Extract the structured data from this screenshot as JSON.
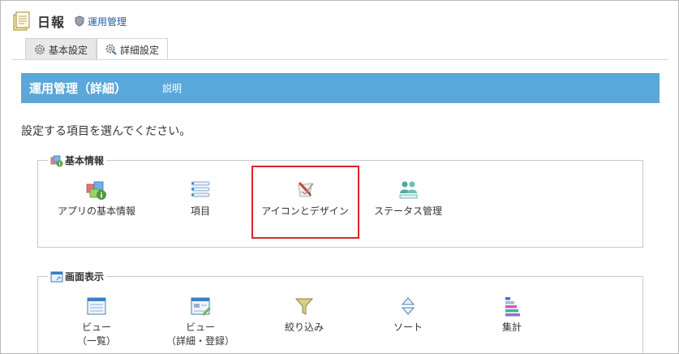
{
  "header": {
    "app_name": "日報",
    "admin_link": "運用管理"
  },
  "tabs": [
    {
      "label": "基本設定",
      "active": false
    },
    {
      "label": "詳細設定",
      "active": true
    }
  ],
  "title_bar": {
    "title": "運用管理（詳細）",
    "help": "説明",
    "color": "#5aa7d9"
  },
  "instruction": "設定する項目を選んでください。",
  "groups": {
    "basic": {
      "legend": "基本情報",
      "items": [
        {
          "label": "アプリの基本情報",
          "icon": "app-info-icon"
        },
        {
          "label": "項目",
          "icon": "fields-list-icon"
        },
        {
          "label": "アイコンとデザイン",
          "icon": "icon-design-icon",
          "highlighted": true
        },
        {
          "label": "ステータス管理",
          "icon": "status-management-icon"
        }
      ]
    },
    "display": {
      "legend": "画面表示",
      "items": [
        {
          "label1": "ビュー",
          "label2": "（一覧）",
          "icon": "view-list-icon"
        },
        {
          "label1": "ビュー",
          "label2": "（詳細・登録）",
          "icon": "view-detail-icon"
        },
        {
          "label1": "絞り込み",
          "icon": "filter-icon"
        },
        {
          "label1": "ソート",
          "icon": "sort-icon"
        },
        {
          "label1": "集計",
          "icon": "aggregate-icon"
        }
      ]
    }
  },
  "highlight_color": "#d9252b"
}
